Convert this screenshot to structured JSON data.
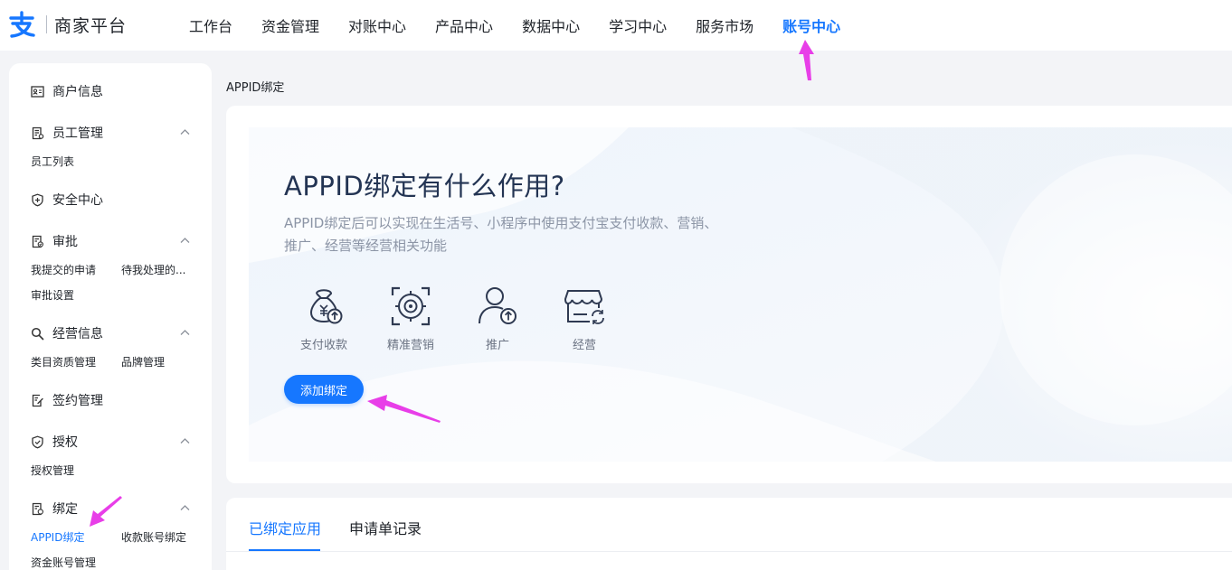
{
  "app": {
    "logo_text": "商家平台"
  },
  "nav": {
    "items": [
      {
        "label": "工作台",
        "active": false
      },
      {
        "label": "资金管理",
        "active": false
      },
      {
        "label": "对账中心",
        "active": false
      },
      {
        "label": "产品中心",
        "active": false
      },
      {
        "label": "数据中心",
        "active": false
      },
      {
        "label": "学习中心",
        "active": false
      },
      {
        "label": "服务市场",
        "active": false
      },
      {
        "label": "账号中心",
        "active": true
      }
    ]
  },
  "sidebar": {
    "groups": [
      {
        "label": "商户信息",
        "icon": "id-card-icon",
        "children": []
      },
      {
        "label": "员工管理",
        "icon": "employee-doc-icon",
        "children": [
          "员工列表"
        ]
      },
      {
        "label": "安全中心",
        "icon": "shield-plus-icon",
        "children": []
      },
      {
        "label": "审批",
        "icon": "approval-doc-icon",
        "children": [
          "我提交的申请",
          "待我处理的...",
          "审批设置"
        ]
      },
      {
        "label": "经营信息",
        "icon": "search-icon",
        "children": [
          "类目资质管理",
          "品牌管理"
        ]
      },
      {
        "label": "签约管理",
        "icon": "contract-edit-icon",
        "children": []
      },
      {
        "label": "授权",
        "icon": "shield-check-icon",
        "children": [
          "授权管理"
        ]
      },
      {
        "label": "绑定",
        "icon": "binding-doc-icon",
        "children": [
          "APPID绑定",
          "收款账号绑定",
          "资金账号管理"
        ]
      }
    ],
    "active_item": "APPID绑定"
  },
  "breadcrumb": "APPID绑定",
  "hero": {
    "title": "APPID绑定有什么作用?",
    "description": "APPID绑定后可以实现在生活号、小程序中使用支付宝支付收款、营销、推广、经营等经营相关功能",
    "features": [
      {
        "label": "支付收款",
        "icon": "money-bag-upload-icon"
      },
      {
        "label": "精准营销",
        "icon": "target-icon"
      },
      {
        "label": "推广",
        "icon": "user-upload-icon"
      },
      {
        "label": "经营",
        "icon": "store-refresh-icon"
      }
    ],
    "button_label": "添加绑定"
  },
  "tabs": [
    {
      "label": "已绑定应用",
      "active": true
    },
    {
      "label": "申请单记录",
      "active": false
    }
  ],
  "colors": {
    "accent": "#1677ff",
    "annotation_arrow": "#e83ee8",
    "hero_title": "#233453",
    "muted_text": "#8c95a6"
  }
}
